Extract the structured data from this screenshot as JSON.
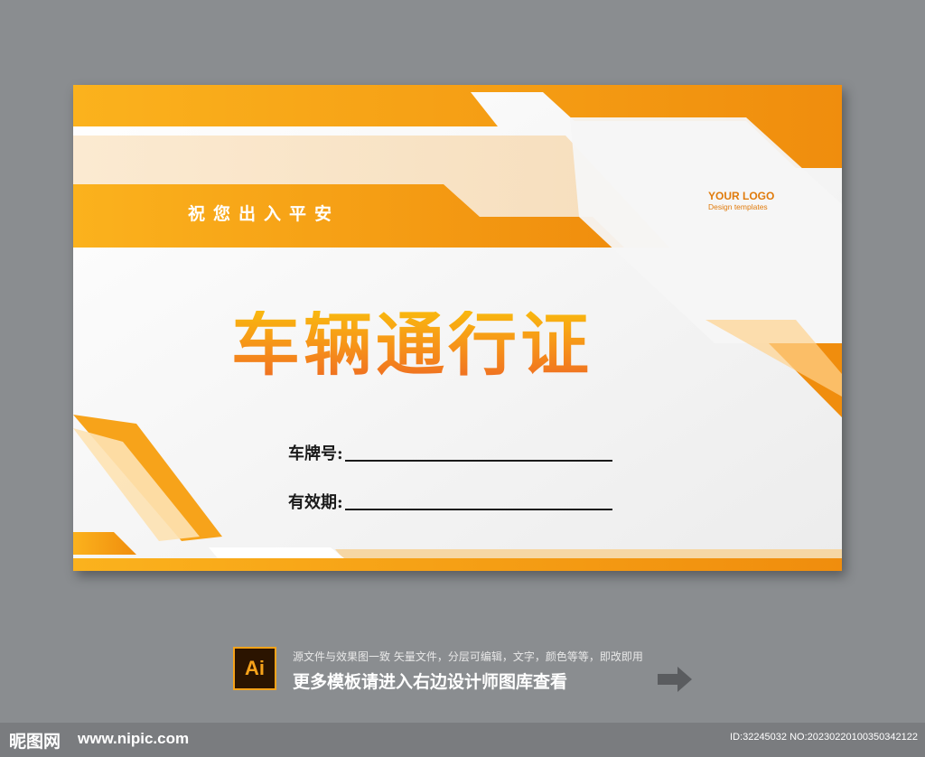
{
  "card": {
    "blessing": "祝您出入平安",
    "logo_title": "YOUR LOGO",
    "logo_subtitle": "Design templates",
    "main_title": "车辆通行证",
    "fields": [
      {
        "label": "车牌号:"
      },
      {
        "label": "有效期:"
      }
    ],
    "colors": {
      "accent": "#f7a31a",
      "accent_dark": "#ef7d11"
    }
  },
  "bottom_bar": {
    "icon_label": "Ai",
    "line1": "源文件与效果图一致 矢量文件，分层可编辑，文字，颜色等等，即改即用",
    "line2": "更多模板请进入右边设计师图库查看"
  },
  "footer": {
    "site_logo": "昵图网",
    "site_url": "www.nipic.com",
    "image_id": "ID:32245032 NO:20230220100350342122"
  }
}
